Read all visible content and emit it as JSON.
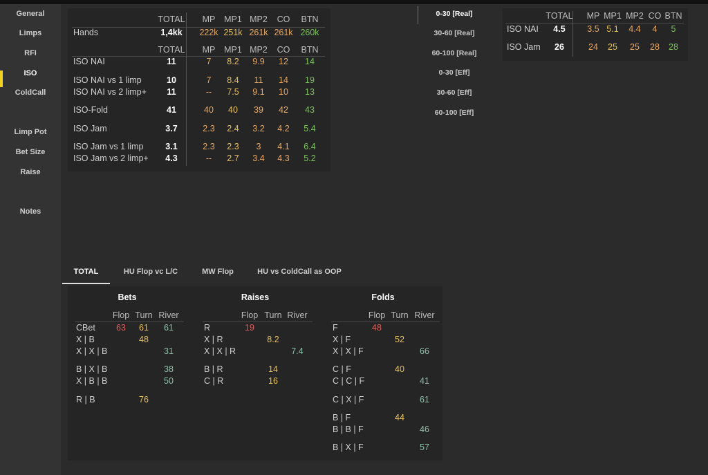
{
  "sidebar": {
    "items": [
      "General",
      "Limps",
      "RFI",
      "ISO",
      "ColdCall",
      "Limp Pot",
      "Bet Size",
      "Raise",
      "Notes"
    ],
    "active": "ISO"
  },
  "main_table": {
    "top_headers": [
      "TOTAL",
      "MP",
      "MP1",
      "MP2",
      "CO",
      "BTN"
    ],
    "hands": {
      "label": "Hands",
      "total": "1,4kk",
      "values": [
        "222k",
        "251k",
        "261k",
        "261k",
        "260k"
      ]
    },
    "headers": [
      "TOTAL",
      "MP",
      "MP1",
      "MP2",
      "CO",
      "BTN"
    ],
    "rows": [
      {
        "label": "ISO NAI",
        "total": "11",
        "values": [
          "7",
          "8.2",
          "9.9",
          "12",
          "14"
        ]
      },
      {
        "label": "ISO NAI vs 1 limp",
        "total": "10",
        "values": [
          "7",
          "8.4",
          "11",
          "14",
          "19"
        ]
      },
      {
        "label": "ISO NAI vs 2 limp+",
        "total": "11",
        "values": [
          "--",
          "7.5",
          "9.1",
          "10",
          "13"
        ]
      },
      {
        "label": "ISO-Fold",
        "total": "41",
        "values": [
          "40",
          "40",
          "39",
          "42",
          "43"
        ]
      },
      {
        "label": "ISO Jam",
        "total": "3.7",
        "values": [
          "2.3",
          "2.4",
          "3.2",
          "4.2",
          "5.4"
        ]
      },
      {
        "label": "ISO Jam vs  1 limp",
        "total": "3.1",
        "values": [
          "2.3",
          "2.3",
          "3",
          "4.1",
          "6.4"
        ]
      },
      {
        "label": "ISO Jam vs 2 limp+",
        "total": "4.3",
        "values": [
          "--",
          "2.7",
          "3.4",
          "4.3",
          "5.2"
        ]
      }
    ]
  },
  "ranges": {
    "items": [
      "0-30 [Real]",
      "30-60 [Real]",
      "60-100 [Real]",
      "0-30 [Eff]",
      "30-60 [Eff]",
      "60-100 [Eff]"
    ],
    "active": "0-30 [Real]"
  },
  "side_table": {
    "headers": [
      "TOTAL",
      "MP",
      "MP1",
      "MP2",
      "CO",
      "BTN"
    ],
    "rows": [
      {
        "label": "ISO  NAI",
        "total": "4.5",
        "values": [
          "3.5",
          "5.1",
          "4.4",
          "4",
          "5"
        ]
      },
      {
        "label": "ISO Jam",
        "total": "26",
        "values": [
          "24",
          "25",
          "25",
          "28",
          "28"
        ]
      }
    ]
  },
  "tabs": {
    "items": [
      "TOTAL",
      "HU Flop vc L/C",
      "MW Flop",
      "HU vs ColdCall as OOP"
    ],
    "active": "TOTAL"
  },
  "postflop": {
    "bets": {
      "title": "Bets",
      "headers": [
        "Flop",
        "Turn",
        "River"
      ],
      "rows": [
        {
          "label": "CBet",
          "flop": "63",
          "turn": "61",
          "river": "61"
        },
        {
          "label": "X | B",
          "flop": "",
          "turn": "48",
          "river": ""
        },
        {
          "label": "X | X | B",
          "flop": "",
          "turn": "",
          "river": "31"
        },
        {
          "label": "B | X | B",
          "flop": "",
          "turn": "",
          "river": "38"
        },
        {
          "label": "X | B | B",
          "flop": "",
          "turn": "",
          "river": "50"
        },
        {
          "label": "R | B",
          "flop": "",
          "turn": "76",
          "river": ""
        }
      ]
    },
    "raises": {
      "title": "Raises",
      "headers": [
        "Flop",
        "Turn",
        "River"
      ],
      "rows": [
        {
          "label": "R",
          "flop": "19",
          "turn": "",
          "river": ""
        },
        {
          "label": "X | R",
          "flop": "",
          "turn": "8.2",
          "river": ""
        },
        {
          "label": "X | X | R",
          "flop": "",
          "turn": "",
          "river": "7.4"
        },
        {
          "label": "B | R",
          "flop": "",
          "turn": "14",
          "river": ""
        },
        {
          "label": "C | R",
          "flop": "",
          "turn": "16",
          "river": ""
        }
      ]
    },
    "folds": {
      "title": "Folds",
      "headers": [
        "Flop",
        "Turn",
        "River"
      ],
      "rows": [
        {
          "label": "F",
          "flop": "48",
          "turn": "",
          "river": ""
        },
        {
          "label": "X | F",
          "flop": "",
          "turn": "52",
          "river": ""
        },
        {
          "label": "X | X | F",
          "flop": "",
          "turn": "",
          "river": "66"
        },
        {
          "label": "C | F",
          "flop": "",
          "turn": "40",
          "river": ""
        },
        {
          "label": "C | C | F",
          "flop": "",
          "turn": "",
          "river": "41"
        },
        {
          "label": "C | X | F",
          "flop": "",
          "turn": "",
          "river": "61"
        },
        {
          "label": "B | F",
          "flop": "",
          "turn": "44",
          "river": ""
        },
        {
          "label": "B | B | F",
          "flop": "",
          "turn": "",
          "river": "46"
        },
        {
          "label": "B | X | F",
          "flop": "",
          "turn": "",
          "river": "57"
        }
      ]
    }
  },
  "colors": {
    "accent": "#f2d21b",
    "orange": "#e8a862",
    "yellow": "#e8c05a",
    "green": "#7bc25a",
    "red": "#e05c5c",
    "teal": "#8fbfaa"
  }
}
